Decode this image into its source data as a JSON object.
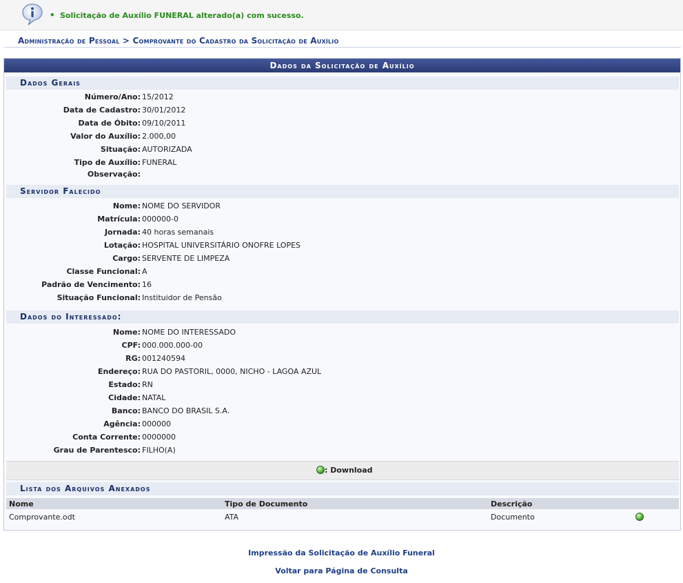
{
  "message": {
    "icon": "info-icon",
    "bullet": "•",
    "text": "Solicitação de Auxílio FUNERAL alterado(a) com sucesso."
  },
  "breadcrumb": "Administração de Pessoal > Comprovante do Cadastro da Solicitação de Auxílio",
  "panel": {
    "caption": "Dados da Solicitação de Auxílio"
  },
  "sections": {
    "dados_gerais": {
      "title": "Dados Gerais",
      "rows": [
        {
          "label": "Número/Ano:",
          "value": "15/2012"
        },
        {
          "label": "Data de Cadastro:",
          "value": "30/01/2012"
        },
        {
          "label": "Data de Óbito:",
          "value": "09/10/2011"
        },
        {
          "label": "Valor do Auxílio:",
          "value": "2.000,00"
        },
        {
          "label": "Situação:",
          "value": "AUTORIZADA"
        },
        {
          "label": "Tipo de Auxílio:",
          "value": "FUNERAL"
        },
        {
          "label": "Observação:",
          "value": ""
        }
      ]
    },
    "servidor": {
      "title": "Servidor Falecido",
      "rows": [
        {
          "label": "Nome:",
          "value": "NOME DO SERVIDOR"
        },
        {
          "label": "Matrícula:",
          "value": "000000-0"
        },
        {
          "label": "Jornada:",
          "value": "40 horas semanais"
        },
        {
          "label": "Lotação:",
          "value": "HOSPITAL UNIVERSITÁRIO ONOFRE LOPES"
        },
        {
          "label": "Cargo:",
          "value": "SERVENTE DE LIMPEZA"
        },
        {
          "label": "Classe Funcional:",
          "value": "A"
        },
        {
          "label": "Padrão de Vencimento:",
          "value": "16"
        },
        {
          "label": "Situação Funcional:",
          "value": "Instituidor de Pensão"
        }
      ]
    },
    "interessado": {
      "title": "Dados do Interessado:",
      "rows": [
        {
          "label": "Nome:",
          "value": "NOME DO INTERESSADO"
        },
        {
          "label": "CPF:",
          "value": "000.000.000-00"
        },
        {
          "label": "RG:",
          "value": "001240594"
        },
        {
          "label": "Endereço:",
          "value": "RUA DO PASTORIL, 0000, NICHO - LAGOA AZUL"
        },
        {
          "label": "Estado:",
          "value": "RN"
        },
        {
          "label": "Cidade:",
          "value": "NATAL"
        },
        {
          "label": "Banco:",
          "value": "BANCO DO BRASIL S.A."
        },
        {
          "label": "Agência:",
          "value": "000000"
        },
        {
          "label": "Conta Corrente:",
          "value": "0000000"
        },
        {
          "label": "Grau de Parentesco:",
          "value": "FILHO(A)"
        }
      ]
    }
  },
  "legend": {
    "icon": "download-icon",
    "label": ": Download"
  },
  "attachments": {
    "title": "Lista dos Arquivos Anexados",
    "columns": [
      "Nome",
      "Tipo de Documento",
      "Descrição"
    ],
    "rows": [
      {
        "nome": "Comprovante.odt",
        "tipo": "ATA",
        "descricao": "Documento"
      }
    ]
  },
  "links": {
    "print": "Impressão da Solicitação de Auxílio Funeral",
    "back": "Voltar para Página de Consulta"
  },
  "colors": {
    "success_text": "#2a8a1d",
    "caption_bg": "#2b3c74",
    "link": "#1f3f87"
  }
}
